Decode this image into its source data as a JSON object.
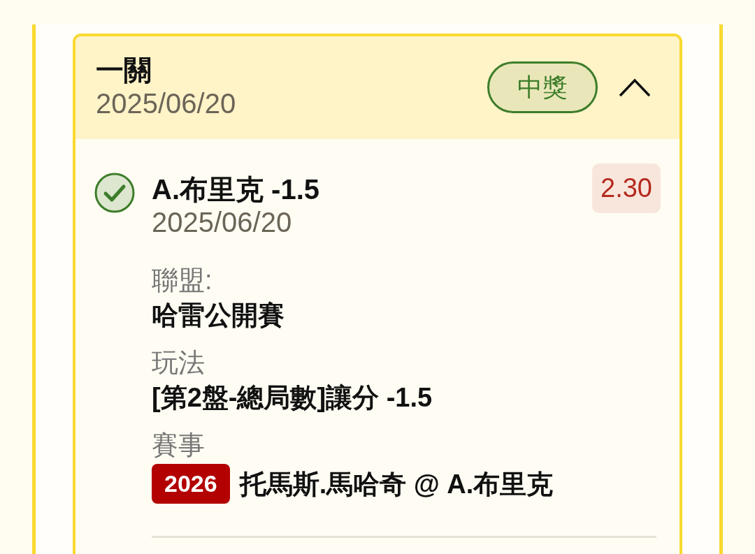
{
  "bet": {
    "title": "一關",
    "date": "2025/06/20",
    "status": {
      "label": "中獎",
      "kind": "won"
    },
    "expanded": true
  },
  "legs": [
    {
      "won": true,
      "selection": "A.布里克 -1.5",
      "date": "2025/06/20",
      "odds": "2.30",
      "details": [
        {
          "kind": "text",
          "label": "聯盟:",
          "value": "哈雷公開賽"
        },
        {
          "kind": "text",
          "label": "玩法",
          "value": "[第2盤-總局數]讓分 -1.5"
        },
        {
          "kind": "event",
          "label": "賽事",
          "tag": "2026",
          "value": "托馬斯.馬哈奇 @ A.布里克"
        }
      ]
    }
  ]
}
